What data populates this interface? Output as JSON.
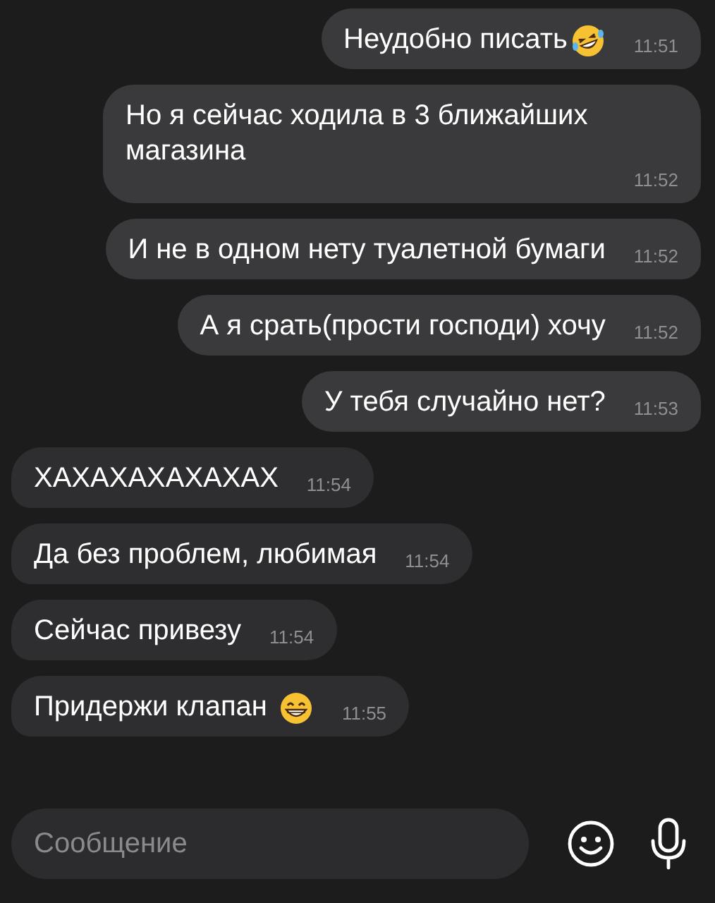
{
  "messages": [
    {
      "outgoing": true,
      "kind": "laughing",
      "text": "Неудобно писать",
      "time": "11:51"
    },
    {
      "outgoing": true,
      "kind": "plain",
      "text": "Но я сейчас ходила в 3 ближайших магазина",
      "time": "11:52"
    },
    {
      "outgoing": true,
      "kind": "plain",
      "text": "И не в одном нету туалетной бумаги",
      "time": "11:52"
    },
    {
      "outgoing": true,
      "kind": "plain",
      "text": "А я срать(прости господи) хочу",
      "time": "11:52"
    },
    {
      "outgoing": true,
      "kind": "plain",
      "text": "У тебя случайно нет?",
      "time": "11:53"
    },
    {
      "outgoing": false,
      "kind": "plain",
      "text": "ХАХАХАХАХАХАХ",
      "time": "11:54"
    },
    {
      "outgoing": false,
      "kind": "plain",
      "text": "Да без проблем, любимая",
      "time": "11:54"
    },
    {
      "outgoing": false,
      "kind": "plain",
      "text": "Сейчас привезу",
      "time": "11:54"
    },
    {
      "outgoing": false,
      "kind": "grinning",
      "text": "Придержи клапан",
      "time": "11:55"
    }
  ],
  "composer": {
    "placeholder": "Сообщение"
  }
}
